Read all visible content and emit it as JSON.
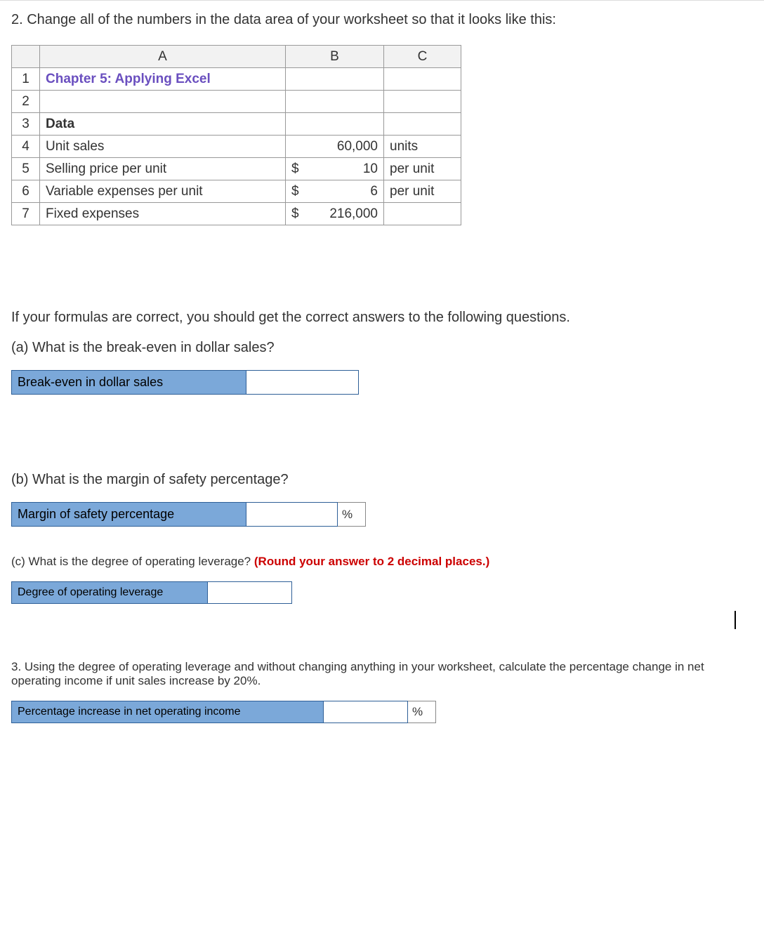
{
  "q2_intro": "2. Change all of the numbers in the data area of your worksheet so that it looks like this:",
  "excel": {
    "col_headers": {
      "a": "A",
      "b": "B",
      "c": "C"
    },
    "rows": {
      "r1": {
        "num": "1",
        "a": "Chapter 5: Applying Excel",
        "b": "",
        "c": ""
      },
      "r2": {
        "num": "2",
        "a": "",
        "b": "",
        "c": ""
      },
      "r3": {
        "num": "3",
        "a": "Data",
        "b": "",
        "c": ""
      },
      "r4": {
        "num": "4",
        "a": "Unit sales",
        "b": "60,000",
        "c": "units"
      },
      "r5": {
        "num": "5",
        "a": "Selling price per unit",
        "b_sym": "$",
        "b_val": "10",
        "c": "per unit"
      },
      "r6": {
        "num": "6",
        "a": "Variable expenses per unit",
        "b_sym": "$",
        "b_val": "6",
        "c": "per unit"
      },
      "r7": {
        "num": "7",
        "a": "Fixed expenses",
        "b_sym": "$",
        "b_val": "216,000",
        "c": ""
      }
    }
  },
  "formulas_text": "If your formulas are correct, you should get the correct answers to the following questions.",
  "part_a": {
    "question": "(a) What is the break-even in dollar sales?",
    "label": "Break-even in dollar sales"
  },
  "part_b": {
    "question": "(b) What is the margin of safety percentage?",
    "label": "Margin of safety percentage",
    "unit": "%"
  },
  "part_c": {
    "question_plain": "(c) What is the degree of operating leverage? ",
    "question_red": "(Round your answer to 2 decimal places.)",
    "label": "Degree of operating leverage"
  },
  "q3": {
    "text": "3. Using the degree of operating leverage and without changing anything in your worksheet, calculate the percentage change in net operating income if unit sales increase by 20%.",
    "label": "Percentage increase in net operating income",
    "unit": "%"
  }
}
